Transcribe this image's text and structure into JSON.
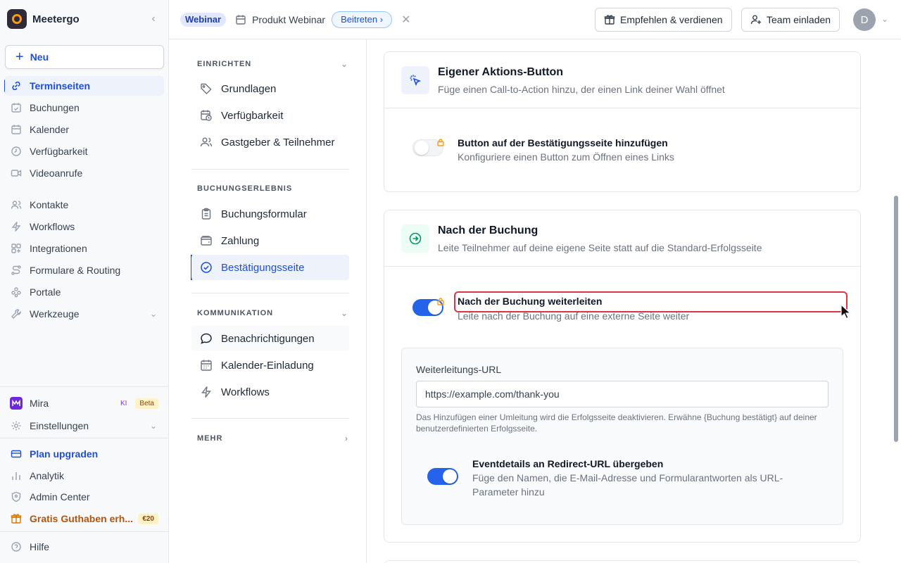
{
  "app": {
    "name": "Meetergo",
    "new_label": "Neu"
  },
  "sidebar": {
    "items": [
      {
        "label": "Terminseiten",
        "icon": "link-icon",
        "active": true
      },
      {
        "label": "Buchungen",
        "icon": "calendar-check-icon"
      },
      {
        "label": "Kalender",
        "icon": "calendar-icon"
      },
      {
        "label": "Verfügbarkeit",
        "icon": "clock-icon"
      },
      {
        "label": "Videoanrufe",
        "icon": "video-icon"
      },
      {
        "label": "Kontakte",
        "icon": "users-icon"
      },
      {
        "label": "Workflows",
        "icon": "lightning-icon"
      },
      {
        "label": "Integrationen",
        "icon": "grid-icon"
      },
      {
        "label": "Formulare & Routing",
        "icon": "route-icon"
      },
      {
        "label": "Portale",
        "icon": "portal-icon"
      },
      {
        "label": "Werkzeuge",
        "icon": "wrench-icon"
      }
    ],
    "bottom": {
      "mira": {
        "label": "Mira",
        "ki": "KI",
        "beta": "Beta"
      },
      "settings": "Einstellungen",
      "upgrade": "Plan upgraden",
      "analytics": "Analytik",
      "admin": "Admin Center",
      "credit": {
        "label": "Gratis Guthaben erh...",
        "badge": "€20"
      },
      "help": "Hilfe"
    }
  },
  "topbar": {
    "tag": "Webinar",
    "title": "Produkt Webinar",
    "join": "Beitreten",
    "recommend": "Empfehlen & verdienen",
    "invite": "Team einladen",
    "avatar": "D"
  },
  "settings_nav": {
    "sections": [
      {
        "title": "EINRICHTEN",
        "items": [
          "Grundlagen",
          "Verfügbarkeit",
          "Gastgeber & Teilnehmer"
        ]
      },
      {
        "title": "BUCHUNGSERLEBNIS",
        "items": [
          "Buchungsformular",
          "Zahlung",
          "Bestätigungsseite"
        ]
      },
      {
        "title": "KOMMUNIKATION",
        "items": [
          "Benachrichtigungen",
          "Kalender-Einladung",
          "Workflows"
        ]
      },
      {
        "title": "MEHR",
        "items": []
      }
    ],
    "active": "Bestätigungsseite"
  },
  "cards": {
    "action_button": {
      "title": "Eigener Aktions-Button",
      "subtitle": "Füge einen Call-to-Action hinzu, der einen Link deiner Wahl öffnet",
      "option_title": "Button auf der Bestätigungsseite hinzufügen",
      "option_desc": "Konfiguriere einen Button zum Öffnen eines Links",
      "enabled": false
    },
    "after_booking": {
      "title": "Nach der Buchung",
      "subtitle": "Leite Teilnehmer auf deine eigene Seite statt auf die Standard-Erfolgsseite",
      "option_title": "Nach der Buchung weiterleiten",
      "option_desc": "Leite nach der Buchung auf eine externe Seite weiter",
      "enabled": true,
      "url_label": "Weiterleitungs-URL",
      "url_value": "https://example.com/thank-you",
      "hint": "Das Hinzufügen einer Umleitung wird die Erfolgsseite deaktivieren. Erwähne {Buchung bestätigt} auf deiner benutzerdefinierten Erfolgsseite.",
      "pass_title": "Eventdetails an Redirect-URL übergeben",
      "pass_desc": "Füge den Namen, die E-Mail-Adresse und Formularantworten als URL-Parameter hinzu",
      "pass_enabled": true
    }
  },
  "colors": {
    "accent": "#1e4fd8",
    "toggle_on": "#2563eb",
    "highlight": "#dc3545",
    "success_icon": "#059669"
  }
}
